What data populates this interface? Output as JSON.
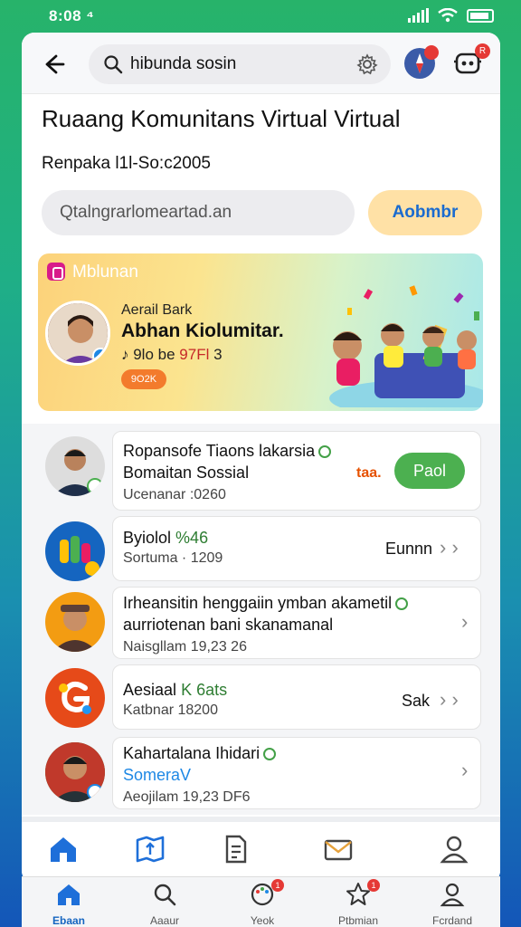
{
  "status_bar": {
    "time": "8:08 ⁴"
  },
  "topbar": {
    "search_value": "hibunda sosin",
    "bot_badge": "R"
  },
  "page": {
    "title": "Ruaang Komunitans Virtual Virtual",
    "subtitle": "Renpaka l1l-So:c2005"
  },
  "composer": {
    "placeholder": "Qtalngrarlomeartad.an",
    "submit_label": "Aobmbr"
  },
  "banner": {
    "brand": "Mblunan",
    "eyebrow": "Aerail Bark",
    "headline": "Abhan Kiolumitar.",
    "meta_prefix": "♪ 9lo be",
    "meta_number": "97Fl",
    "meta_suffix": "3",
    "chip": "9O2K",
    "gradient_start": "#fcd27a",
    "gradient_end": "#a8e8ea"
  },
  "list": [
    {
      "title": "Ropansofe Tiaons lakarsia",
      "title2": "Bomaitan Sossial",
      "sub": "Ucenanar :0260",
      "tag": "taa.",
      "action": "Paol",
      "avatar_color": "#5b3a2a"
    },
    {
      "title": "Byiolol",
      "title_accent": "%46",
      "sub": "Sortuma · 1209",
      "action": "Eunnn",
      "avatar_color": "#1565c0"
    },
    {
      "title": "Irheansitin henggaiin ymban akametil",
      "title2": "aurriotenan bani skanamanal",
      "sub": "Naisgllam 19,23 26",
      "avatar_color": "#f39c12"
    },
    {
      "title": "Aesiaal",
      "title_accent": "K 6ats",
      "sub": "Katbnar 18200",
      "action": "Sak",
      "avatar_color": "#e64a19"
    },
    {
      "title": "Kahartalana Ihidari",
      "title2": "SomeraV",
      "sub": "Aeojilam 19,23 DF6",
      "avatar_color": "#2e7d32"
    }
  ],
  "bottom_nav": [
    {
      "label": "Ebaan",
      "icon": "home-icon",
      "active": true
    },
    {
      "label": "Aaaur",
      "icon": "search-icon"
    },
    {
      "label": "Yeok",
      "icon": "palette-icon",
      "badge": "1"
    },
    {
      "label": "Ptbmian",
      "icon": "star-icon",
      "badge": "1"
    },
    {
      "label": "Fcrdand",
      "icon": "profile-icon"
    }
  ],
  "colors": {
    "accent": "#1565c0",
    "follow": "#4cb050",
    "badge": "#e53935"
  }
}
